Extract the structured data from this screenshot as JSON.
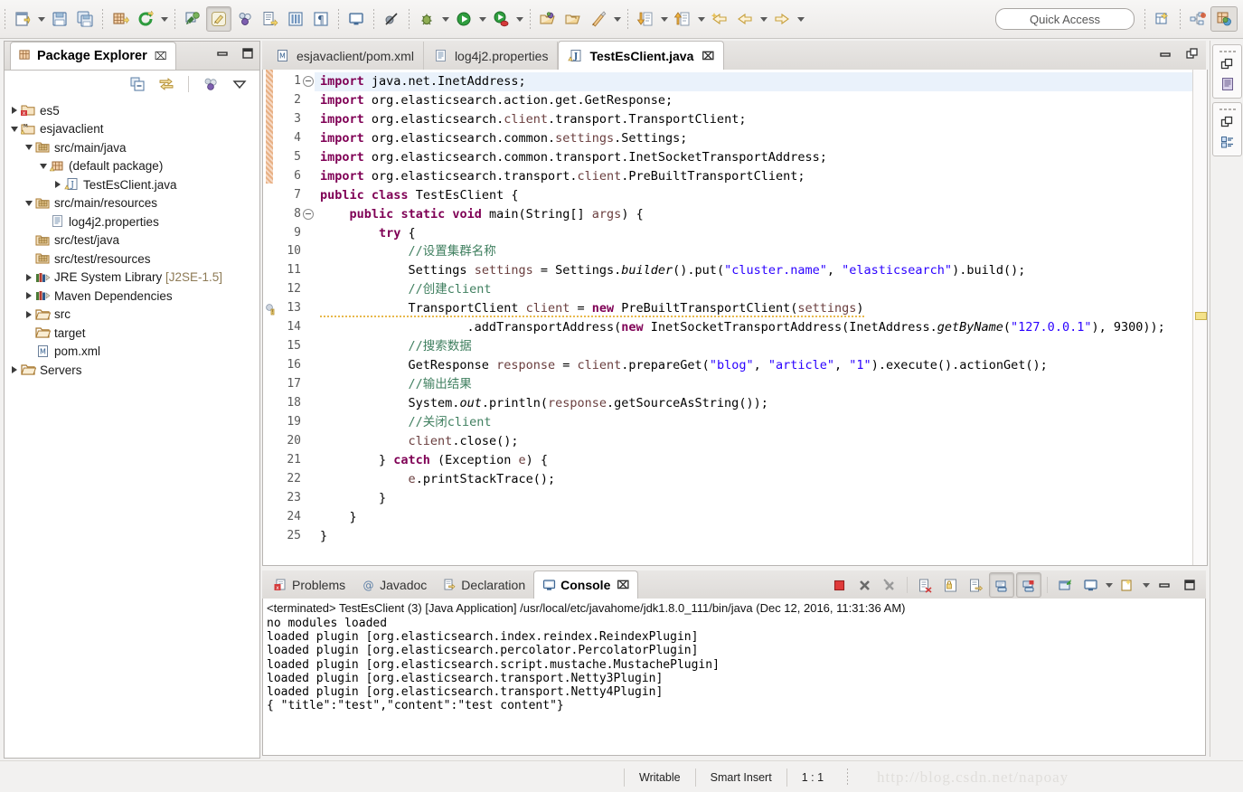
{
  "toolbar": {
    "groups": [
      {
        "items": [
          {
            "name": "new-wizard-icon",
            "label": "New"
          },
          {
            "name": "new-dropdown-arrow",
            "label": "New menu"
          },
          {
            "name": "save-icon",
            "label": "Save"
          },
          {
            "name": "save-all-icon",
            "label": "Save All"
          }
        ]
      },
      {
        "items": [
          {
            "name": "new-java-package-icon",
            "label": "New Java Package"
          },
          {
            "name": "refresh-icon",
            "label": "Refresh"
          },
          {
            "name": "refresh-dropdown-arrow",
            "label": "Refresh menu"
          }
        ]
      },
      {
        "items": [
          {
            "name": "new-annotation-icon",
            "label": "New Annotation"
          },
          {
            "name": "toggle-mark-occurrences-icon",
            "label": "Toggle Mark Occurrences"
          },
          {
            "name": "link-with-editor-icon",
            "label": "Link with Editor"
          },
          {
            "name": "open-task-icon",
            "label": "Open Task"
          },
          {
            "name": "open-type-icon",
            "label": "Open Type"
          },
          {
            "name": "show-whitespace-icon",
            "label": "Show Whitespace Characters"
          }
        ]
      },
      {
        "items": [
          {
            "name": "open-console-icon",
            "label": "Open Console"
          }
        ]
      },
      {
        "items": [
          {
            "name": "skip-breakpoints-icon",
            "label": "Skip All Breakpoints"
          }
        ]
      },
      {
        "items": [
          {
            "name": "debug-icon",
            "label": "Debug"
          },
          {
            "name": "debug-dropdown-arrow",
            "label": "Debug menu"
          },
          {
            "name": "run-icon",
            "label": "Run"
          },
          {
            "name": "run-dropdown-arrow",
            "label": "Run menu"
          },
          {
            "name": "run-external-tools-icon",
            "label": "External Tools"
          },
          {
            "name": "external-tools-dropdown-arrow",
            "label": "External Tools menu"
          }
        ]
      },
      {
        "items": [
          {
            "name": "open-perspective-icon",
            "label": "Open Perspective"
          },
          {
            "name": "open-folder-icon",
            "label": "Open Resource"
          },
          {
            "name": "search-icon",
            "label": "Search"
          },
          {
            "name": "search-dropdown-arrow",
            "label": "Search menu"
          }
        ]
      },
      {
        "items": [
          {
            "name": "previous-annotation-icon",
            "label": "Previous Annotation"
          },
          {
            "name": "previous-annotation-dropdown-arrow",
            "label": "Previous Annotation menu"
          },
          {
            "name": "next-annotation-icon",
            "label": "Next Annotation"
          },
          {
            "name": "next-annotation-dropdown-arrow",
            "label": "Next Annotation menu"
          },
          {
            "name": "last-edit-location-icon",
            "label": "Last Edit Location"
          },
          {
            "name": "back-icon",
            "label": "Back"
          },
          {
            "name": "back-dropdown-arrow",
            "label": "Back menu"
          },
          {
            "name": "forward-icon",
            "label": "Forward"
          },
          {
            "name": "forward-dropdown-arrow",
            "label": "Forward menu"
          }
        ]
      }
    ],
    "quick_access_placeholder": "Quick Access",
    "perspective_new_icon": "new-perspective-icon",
    "perspectives": [
      {
        "name": "perspective-java-ee",
        "label": "Java EE",
        "active": false
      },
      {
        "name": "perspective-java",
        "label": "Java",
        "active": true
      }
    ]
  },
  "package_explorer": {
    "title": "Package Explorer",
    "tab_icon": "package-explorer-icon",
    "close_glyph": "⌧",
    "minimize_label": "Minimize",
    "maximize_label": "Maximize",
    "toolbar": [
      {
        "name": "collapse-all-icon",
        "label": "Collapse All"
      },
      {
        "name": "link-with-editor-icon",
        "label": "Link with Editor"
      },
      {
        "name": "view-menu-filters-icon",
        "label": "Filters"
      },
      {
        "name": "view-menu-icon",
        "label": "View Menu"
      }
    ],
    "tree": [
      {
        "label": "es5",
        "indent": 0,
        "twisty": "collapsed",
        "icon": "project-closed-icon"
      },
      {
        "label": "esjavaclient",
        "indent": 0,
        "twisty": "expanded",
        "icon": "project-open-icon"
      },
      {
        "label": "src/main/java",
        "indent": 1,
        "twisty": "expanded",
        "icon": "source-folder-icon"
      },
      {
        "label": "(default package)",
        "indent": 2,
        "twisty": "expanded",
        "icon": "package-icon"
      },
      {
        "label": "TestEsClient.java",
        "indent": 3,
        "twisty": "collapsed",
        "icon": "java-file-icon"
      },
      {
        "label": "src/main/resources",
        "indent": 1,
        "twisty": "expanded",
        "icon": "source-folder-icon"
      },
      {
        "label": "log4j2.properties",
        "indent": 2,
        "twisty": "none",
        "icon": "properties-file-icon"
      },
      {
        "label": "src/test/java",
        "indent": 1,
        "twisty": "none",
        "icon": "source-folder-icon"
      },
      {
        "label": "src/test/resources",
        "indent": 1,
        "twisty": "none",
        "icon": "source-folder-icon"
      },
      {
        "label": "JRE System Library",
        "indent": 1,
        "twisty": "collapsed",
        "icon": "library-icon",
        "suffix": "[J2SE-1.5]"
      },
      {
        "label": "Maven Dependencies",
        "indent": 1,
        "twisty": "collapsed",
        "icon": "library-icon"
      },
      {
        "label": "src",
        "indent": 1,
        "twisty": "collapsed",
        "icon": "folder-icon"
      },
      {
        "label": "target",
        "indent": 1,
        "twisty": "none",
        "icon": "folder-icon"
      },
      {
        "label": "pom.xml",
        "indent": 1,
        "twisty": "none",
        "icon": "xml-file-icon"
      },
      {
        "label": "Servers",
        "indent": 0,
        "twisty": "collapsed",
        "icon": "folder-icon"
      }
    ]
  },
  "editor": {
    "tabs": [
      {
        "label": "esjavaclient/pom.xml",
        "icon": "xml-file-icon",
        "active": false,
        "closable": false
      },
      {
        "label": "log4j2.properties",
        "icon": "properties-file-icon",
        "active": false,
        "closable": false
      },
      {
        "label": "TestEsClient.java",
        "icon": "java-file-icon",
        "active": true,
        "closable": true
      }
    ],
    "close_glyph": "⌧",
    "minimize_label": "Minimize",
    "maximize_label": "Restore",
    "line_count": 25,
    "first_line": 1,
    "fold_lines": [
      1,
      8
    ],
    "warning_line": 13,
    "change_bar_lines": [
      1,
      6
    ],
    "code_lines": [
      "import java.net.InetAddress;",
      "import org.elasticsearch.action.get.GetResponse;",
      "import org.elasticsearch.client.transport.TransportClient;",
      "import org.elasticsearch.common.settings.Settings;",
      "import org.elasticsearch.common.transport.InetSocketTransportAddress;",
      "import org.elasticsearch.transport.client.PreBuiltTransportClient;",
      "public class TestEsClient {",
      "    public static void main(String[] args) {",
      "        try {",
      "            //设置集群名称",
      "            Settings settings = Settings.builder().put(\"cluster.name\", \"elasticsearch\").build();",
      "            //创建client",
      "            TransportClient client = new PreBuiltTransportClient(settings)",
      "                    .addTransportAddress(new InetSocketTransportAddress(InetAddress.getByName(\"127.0.0.1\"), 9300));",
      "            //搜索数据",
      "            GetResponse response = client.prepareGet(\"blog\", \"article\", \"1\").execute().actionGet();",
      "            //输出结果",
      "            System.out.println(response.getSourceAsString());",
      "            //关闭client",
      "            client.close();",
      "        } catch (Exception e) {",
      "            e.printStackTrace();",
      "        }",
      "    }",
      "}"
    ]
  },
  "console": {
    "tabs": [
      {
        "label": "Problems",
        "icon": "problems-icon",
        "active": false
      },
      {
        "label": "Javadoc",
        "icon": "javadoc-icon",
        "active": false
      },
      {
        "label": "Declaration",
        "icon": "declaration-icon",
        "active": false
      },
      {
        "label": "Console",
        "icon": "console-icon",
        "active": true
      }
    ],
    "close_glyph": "⌧",
    "toolbar": [
      {
        "name": "terminate-icon",
        "label": "Terminate"
      },
      {
        "name": "remove-launch-icon",
        "label": "Remove Launch"
      },
      {
        "name": "remove-all-terminated-icon",
        "label": "Remove All Terminated Launches"
      },
      {
        "name": "clear-console-icon",
        "label": "Clear Console"
      },
      {
        "name": "scroll-lock-icon",
        "label": "Scroll Lock"
      },
      {
        "name": "word-wrap-icon",
        "label": "Word Wrap"
      },
      {
        "name": "show-console-on-output-icon",
        "label": "Show Console When Standard Out Changes"
      },
      {
        "name": "show-console-on-error-icon",
        "label": "Show Console When Standard Error Changes"
      },
      {
        "name": "pin-console-icon",
        "label": "Pin Console"
      },
      {
        "name": "display-selected-console-icon",
        "label": "Display Selected Console"
      },
      {
        "name": "display-console-dropdown-arrow",
        "label": "Display Selected Console menu"
      },
      {
        "name": "open-console-icon",
        "label": "Open Console"
      },
      {
        "name": "open-console-dropdown-arrow",
        "label": "Open Console menu"
      },
      {
        "name": "minimize-icon",
        "label": "Minimize"
      },
      {
        "name": "maximize-icon",
        "label": "Maximize"
      }
    ],
    "header": "<terminated> TestEsClient (3) [Java Application] /usr/local/etc/javahome/jdk1.8.0_111/bin/java (Dec 12, 2016, 11:31:36 AM)",
    "output": [
      "no modules loaded",
      "loaded plugin [org.elasticsearch.index.reindex.ReindexPlugin]",
      "loaded plugin [org.elasticsearch.percolator.PercolatorPlugin]",
      "loaded plugin [org.elasticsearch.script.mustache.MustachePlugin]",
      "loaded plugin [org.elasticsearch.transport.Netty3Plugin]",
      "loaded plugin [org.elasticsearch.transport.Netty4Plugin]",
      "{ \"title\":\"test\",\"content\":\"test content\"}"
    ]
  },
  "fastbar": {
    "boxes": [
      {
        "restore_icon": "restore-icon",
        "view_icon": "outline-icon",
        "label": "Outline"
      },
      {
        "restore_icon": "restore-icon",
        "view_icon": "task-list-icon",
        "label": "Task List"
      }
    ]
  },
  "statusbar": {
    "writable": "Writable",
    "insert_mode": "Smart Insert",
    "position": "1 : 1",
    "watermark": "http://blog.csdn.net/napoay"
  },
  "colors": {
    "keyword": "#7f0055",
    "string": "#2a00ff",
    "comment": "#3f7f5f",
    "field": "#0000c0",
    "local": "#6a3e3e",
    "current_line": "#eaf2fb",
    "warning": "#f4e28a",
    "chrome": "#f2f1f0"
  }
}
